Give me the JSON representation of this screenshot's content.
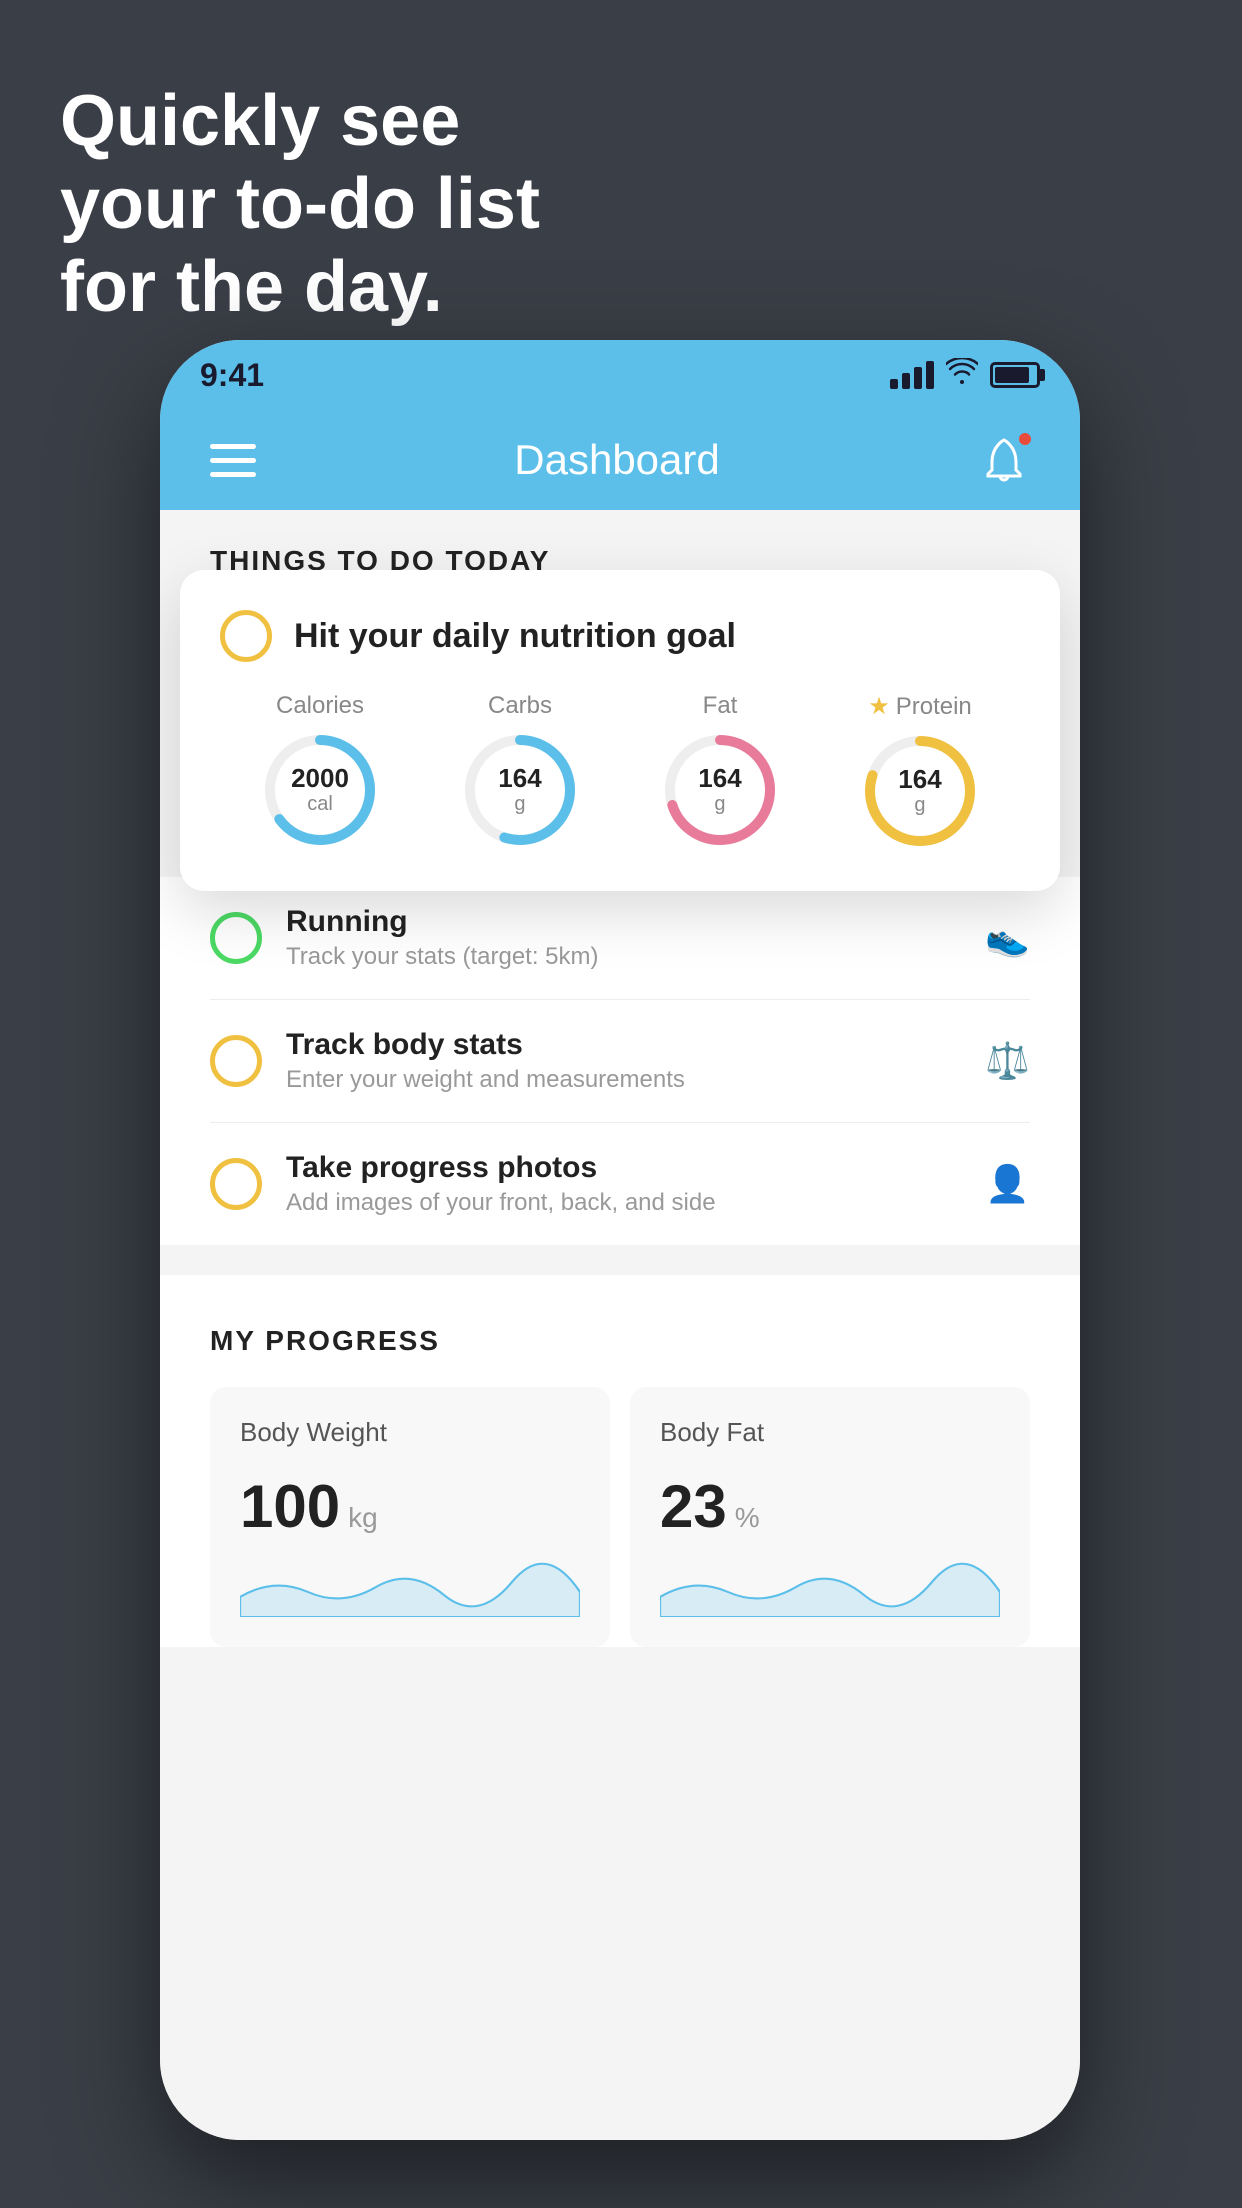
{
  "headline": {
    "line1": "Quickly see",
    "line2": "your to-do list",
    "line3": "for the day."
  },
  "phone": {
    "statusBar": {
      "time": "9:41",
      "signalBars": [
        8,
        12,
        18,
        24
      ],
      "hasBattery": true
    },
    "navBar": {
      "title": "Dashboard",
      "menuLabel": "menu",
      "bellLabel": "notifications"
    },
    "sectionHeader": "THINGS TO DO TODAY",
    "floatingCard": {
      "title": "Hit your daily nutrition goal",
      "circleColor": "#f0c040",
      "nutrients": [
        {
          "label": "Calories",
          "value": "2000",
          "unit": "cal",
          "color": "#5bbfea",
          "percent": 65,
          "starred": false
        },
        {
          "label": "Carbs",
          "value": "164",
          "unit": "g",
          "color": "#5bbfea",
          "percent": 55,
          "starred": false
        },
        {
          "label": "Fat",
          "value": "164",
          "unit": "g",
          "color": "#e87b9a",
          "percent": 70,
          "starred": false
        },
        {
          "label": "Protein",
          "value": "164",
          "unit": "g",
          "color": "#f0c040",
          "percent": 80,
          "starred": true
        }
      ]
    },
    "listItems": [
      {
        "title": "Running",
        "subtitle": "Track your stats (target: 5km)",
        "circleColor": "green",
        "icon": "👟"
      },
      {
        "title": "Track body stats",
        "subtitle": "Enter your weight and measurements",
        "circleColor": "yellow",
        "icon": "⚖️"
      },
      {
        "title": "Take progress photos",
        "subtitle": "Add images of your front, back, and side",
        "circleColor": "yellow",
        "icon": "👤"
      }
    ],
    "progressSection": {
      "title": "MY PROGRESS",
      "cards": [
        {
          "title": "Body Weight",
          "value": "100",
          "unit": "kg"
        },
        {
          "title": "Body Fat",
          "value": "23",
          "unit": "%"
        }
      ]
    }
  }
}
